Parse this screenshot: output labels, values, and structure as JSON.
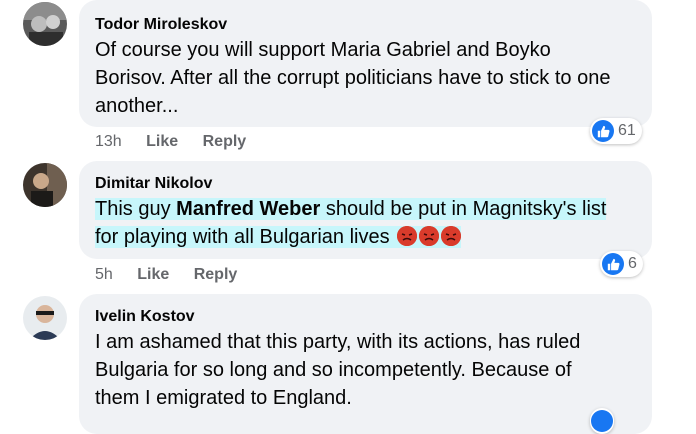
{
  "comments": [
    {
      "author": "Todor Miroleskov",
      "text": "Of course you will support Maria Gabriel and Boyko Borisov. After all the corrupt politicians have to stick to one another...",
      "time": "13h",
      "like_label": "Like",
      "reply_label": "Reply",
      "reaction_count": "61"
    },
    {
      "author": "Dimitar Nikolov",
      "text_pre": "This guy ",
      "text_bold": "Manfred Weber",
      "text_post": " should be put in Magnitsky's list for playing with all Bulgarian lives ",
      "time": "5h",
      "like_label": "Like",
      "reply_label": "Reply",
      "reaction_count": "6",
      "emojis": [
        "angry-face-icon",
        "angry-face-icon",
        "angry-face-icon"
      ]
    },
    {
      "author": "Ivelin Kostov",
      "text": "I am ashamed that this party, with its actions, has ruled Bulgaria for so long and so incompetently. Because of them I emigrated to England."
    }
  ],
  "colors": {
    "bubble": "#f0f2f5",
    "highlight": "#c7f6fb",
    "like_blue": "#1877f2",
    "meta_gray": "#65676b",
    "angry_red": "#d93b2b"
  }
}
